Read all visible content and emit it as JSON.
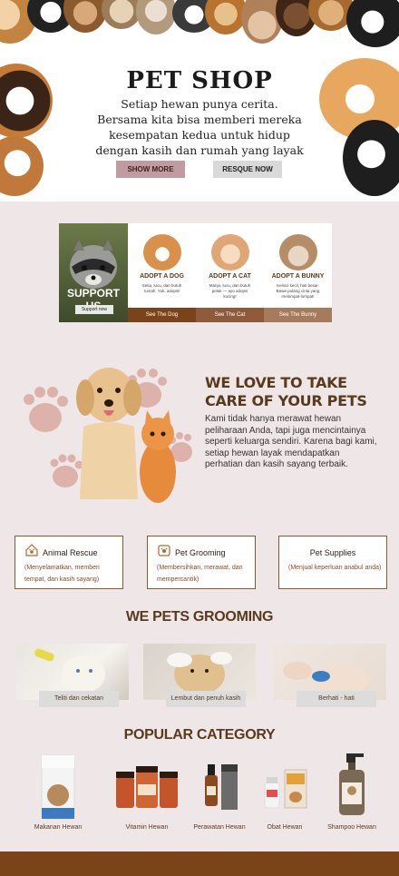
{
  "hero": {
    "title": "PET SHOP",
    "text": "Setiap hewan punya cerita. Bersama kita bisa memberi mereka kesempatan kedua untuk hidup dengan kasih dan rumah yang layak",
    "show_more_label": "SHOW MORE",
    "rescue_label": "RESQUE NOW"
  },
  "support": {
    "title": "SUPPORT US",
    "button_label": "Support now",
    "cards": [
      {
        "title": "ADOPT A DOG",
        "desc": "Setia, lucu, dan butuh rumah. Yuk, adopsi!",
        "button": "See The Dog",
        "color": "#7a4318"
      },
      {
        "title": "ADOPT A CAT",
        "desc": "Manja, lucu, dan butuh peluk — ayo adopsi kucing!",
        "button": "See The Cat",
        "color": "#8e5a3a"
      },
      {
        "title": "ADOPT A BUNNY",
        "desc": "Kelinci kecil, hati besar. Bawa pulang cinta yang melompat-lompat!",
        "button": "See The Bunny",
        "color": "#a67a5a"
      }
    ]
  },
  "care": {
    "title": "WE LOVE TO TAKE CARE OF YOUR PETS",
    "text": "Kami tidak hanya merawat hewan peliharaan Anda, tapi juga mencintainya seperti keluarga sendiri. Karena bagi kami, setiap hewan layak mendapatkan perhatian dan kasih sayang terbaik."
  },
  "services": [
    {
      "title": "Animal Rescue",
      "subtitle": "(Menyelamatkan, memberi tempat, dan kasih sayang)",
      "icon": "home-paw-icon"
    },
    {
      "title": "Pet Grooming",
      "subtitle": "(Membersihkan, merawat, dan mempercantik)",
      "icon": "grooming-icon"
    },
    {
      "title": "Pet Supplies",
      "subtitle": "(Menjual keperluan anabul anda)",
      "icon": ""
    }
  ],
  "grooming": {
    "title": "WE PETS GROOMING",
    "items": [
      "Teliti dan cekatan",
      "Lembut dan penuh kasih",
      "Berhati - hati"
    ]
  },
  "category": {
    "title": "POPULAR CATEGORY",
    "items": [
      "Makanan Hewan",
      "Vitamin Hewan",
      "Perawatan Hewan",
      "Obat Hewan",
      "Shampoo Hewan"
    ]
  },
  "colors": {
    "brand": "#7a4318",
    "accent": "#c19ba1",
    "background": "#efe7e7"
  }
}
